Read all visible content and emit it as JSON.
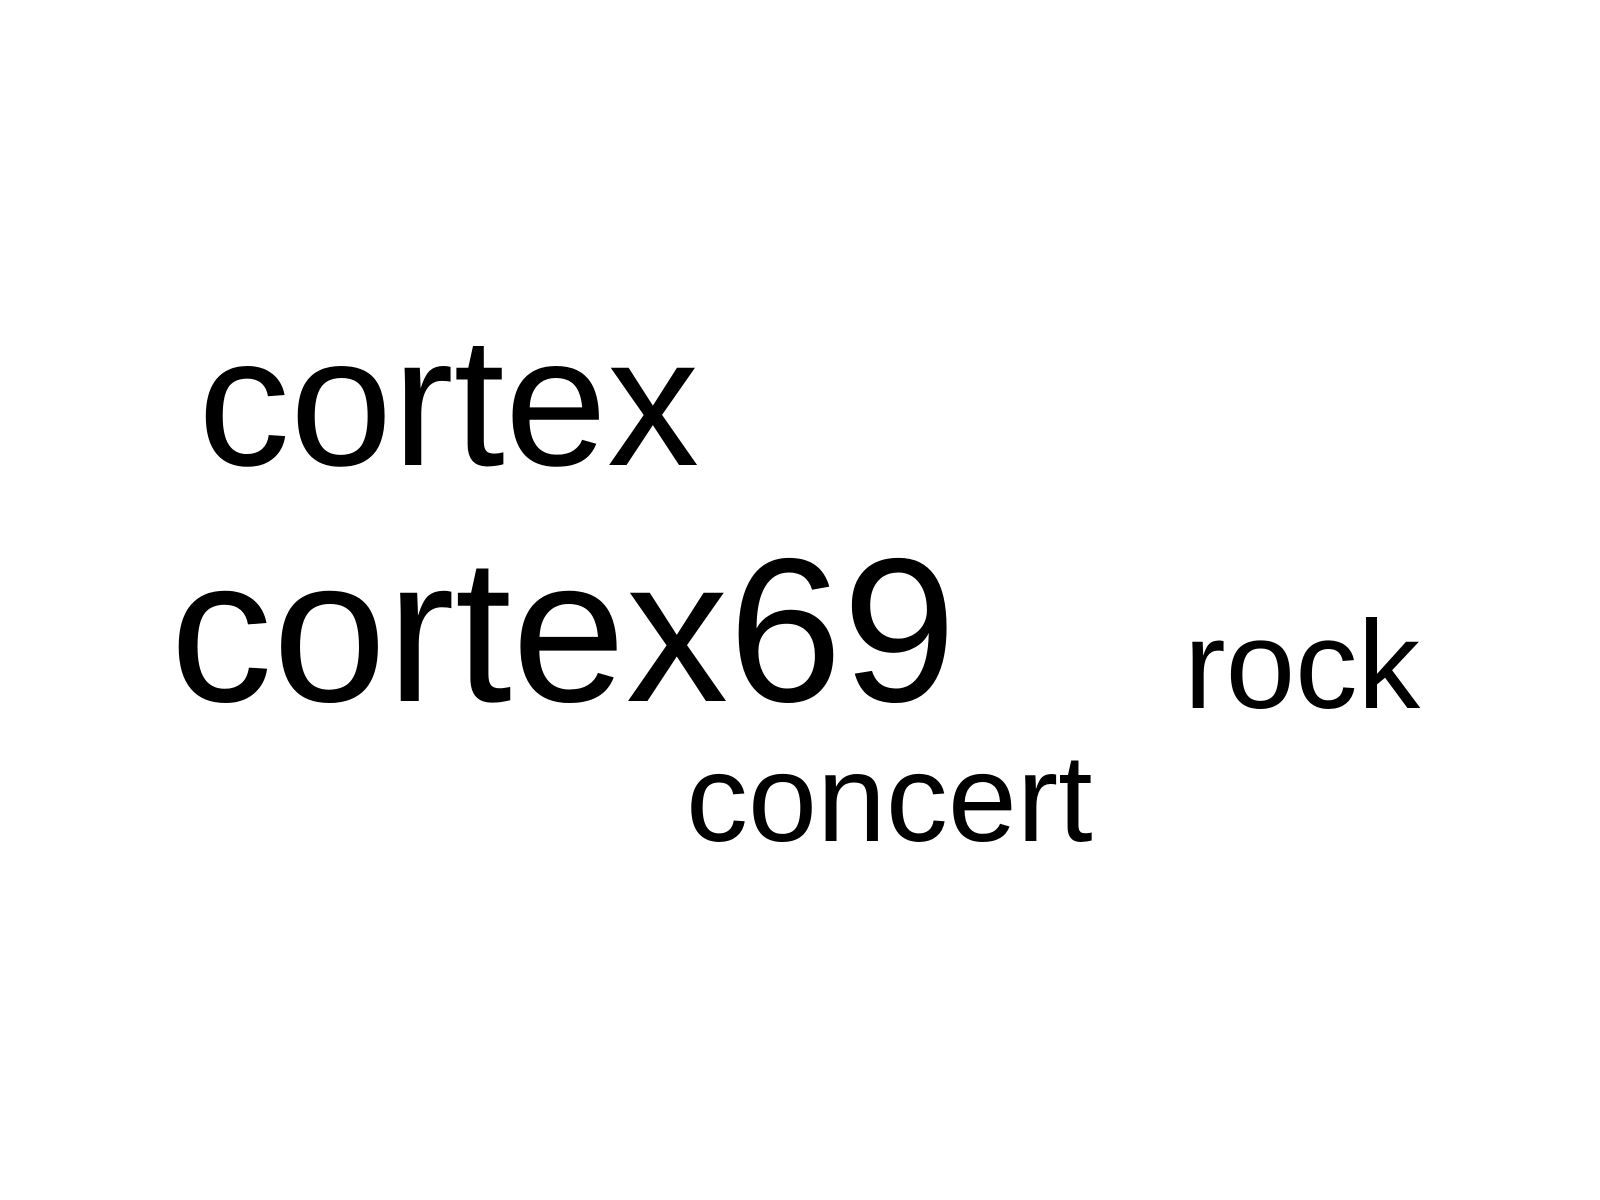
{
  "words": {
    "cortex": "cortex",
    "cortex69": "cortex69",
    "rock": "rock",
    "concert": "concert"
  },
  "colors": {
    "text": "#000000",
    "background": "#ffffff"
  }
}
